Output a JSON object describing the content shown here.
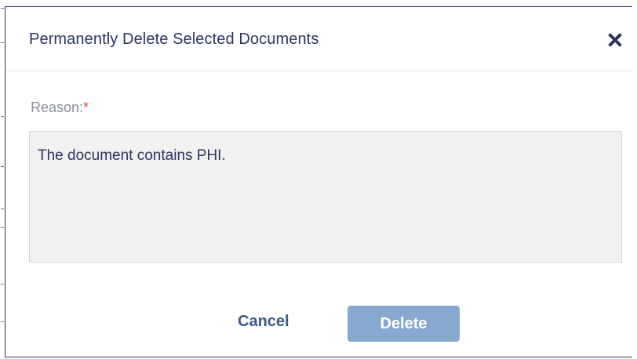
{
  "dialog": {
    "title": "Permanently Delete Selected Documents",
    "close_icon": "close-icon"
  },
  "reason": {
    "label": "Reason:",
    "required_marker": "*",
    "value": "The document contains PHI."
  },
  "actions": {
    "cancel_label": "Cancel",
    "delete_label": "Delete"
  },
  "colors": {
    "title_text": "#2c3560",
    "label_text": "#8a8f99",
    "required": "#d9534f",
    "textarea_bg": "#f1f1f1",
    "cancel_text": "#3a5c84",
    "delete_bg": "#87a9cf",
    "delete_text": "#ffffff"
  }
}
